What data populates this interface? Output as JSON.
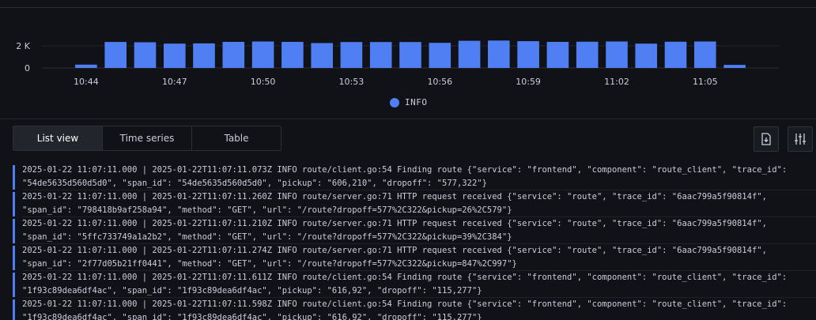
{
  "chart_data": {
    "type": "bar",
    "yticks": [
      "2 K",
      "0"
    ],
    "ylim": [
      0,
      2500
    ],
    "xticks": [
      "10:44",
      "10:47",
      "10:50",
      "10:53",
      "10:56",
      "10:59",
      "11:02",
      "11:05"
    ],
    "categories": [
      "10:43",
      "10:44",
      "10:45",
      "10:46",
      "10:47",
      "10:48",
      "10:49",
      "10:50",
      "10:51",
      "10:52",
      "10:53",
      "10:54",
      "10:55",
      "10:56",
      "10:57",
      "10:58",
      "10:59",
      "11:00",
      "11:01",
      "11:02",
      "11:03",
      "11:04",
      "11:05",
      "11:06",
      "11:07"
    ],
    "values": [
      0,
      300,
      2350,
      2320,
      2200,
      2220,
      2360,
      2390,
      2360,
      2250,
      2340,
      2340,
      2340,
      2270,
      2460,
      2480,
      2420,
      2360,
      2370,
      2390,
      2200,
      2370,
      2390,
      280,
      0
    ],
    "color": "#4f7ff2",
    "legend": [
      "INFO"
    ]
  },
  "tabs": [
    {
      "label": "List view",
      "active": true
    },
    {
      "label": "Time series",
      "active": false
    },
    {
      "label": "Table",
      "active": false
    }
  ],
  "toolbar": {
    "download_icon": "download-icon",
    "settings_icon": "sliders-icon"
  },
  "logs": [
    {
      "l1": "2025-01-22 11:07:11.000 | 2025-01-22T11:07:11.073Z INFO route/client.go:54 Finding route {\"service\": \"frontend\", \"component\": \"route_client\", \"trace_id\":",
      "l2": "\"54de5635d560d5d0\", \"span_id\": \"54de5635d560d5d0\", \"pickup\": \"606,210\", \"dropoff\": \"577,322\"}"
    },
    {
      "l1": "2025-01-22 11:07:11.000 | 2025-01-22T11:07:11.260Z INFO route/server.go:71 HTTP request received {\"service\": \"route\", \"trace_id\": \"6aac799a5f90814f\",",
      "l2": "\"span_id\": \"798418b9af258a94\", \"method\": \"GET\", \"url\": \"/route?dropoff=577%2C322&pickup=26%2C579\"}"
    },
    {
      "l1": "2025-01-22 11:07:11.000 | 2025-01-22T11:07:11.210Z INFO route/server.go:71 HTTP request received {\"service\": \"route\", \"trace_id\": \"6aac799a5f90814f\",",
      "l2": "\"span_id\": \"5ffc733749a1a2b2\", \"method\": \"GET\", \"url\": \"/route?dropoff=577%2C322&pickup=39%2C384\"}"
    },
    {
      "l1": "2025-01-22 11:07:11.000 | 2025-01-22T11:07:11.274Z INFO route/server.go:71 HTTP request received {\"service\": \"route\", \"trace_id\": \"6aac799a5f90814f\",",
      "l2": "\"span_id\": \"2f77d05b21ff0441\", \"method\": \"GET\", \"url\": \"/route?dropoff=577%2C322&pickup=847%2C997\"}"
    },
    {
      "l1": "2025-01-22 11:07:11.000 | 2025-01-22T11:07:11.611Z INFO route/client.go:54 Finding route {\"service\": \"frontend\", \"component\": \"route_client\", \"trace_id\":",
      "l2": "\"1f93c89dea6df4ac\", \"span_id\": \"1f93c89dea6df4ac\", \"pickup\": \"616,92\", \"dropoff\": \"115,277\"}"
    },
    {
      "l1": "2025-01-22 11:07:11.000 | 2025-01-22T11:07:11.598Z INFO route/client.go:54 Finding route {\"service\": \"frontend\", \"component\": \"route_client\", \"trace_id\":",
      "l2": "\"1f93c89dea6df4ac\", \"span_id\": \"1f93c89dea6df4ac\", \"pickup\": \"616,92\", \"dropoff\": \"115,277\"}"
    }
  ]
}
